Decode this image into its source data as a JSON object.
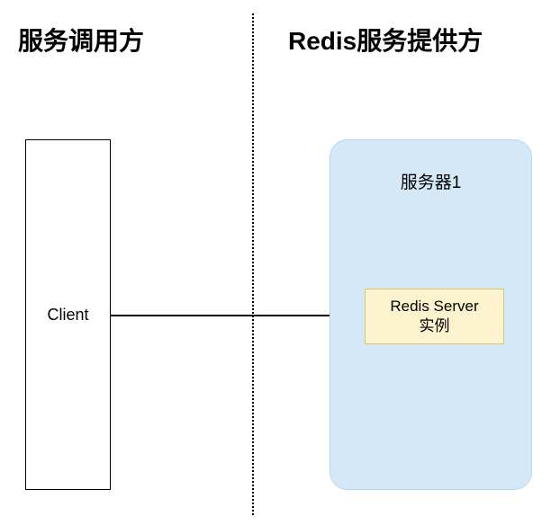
{
  "headers": {
    "left": "服务调用方",
    "right": "Redis服务提供方"
  },
  "client": {
    "label": "Client"
  },
  "server": {
    "title": "服务器1",
    "redis_label_line1": "Redis Server",
    "redis_label_line2": "实例"
  }
}
